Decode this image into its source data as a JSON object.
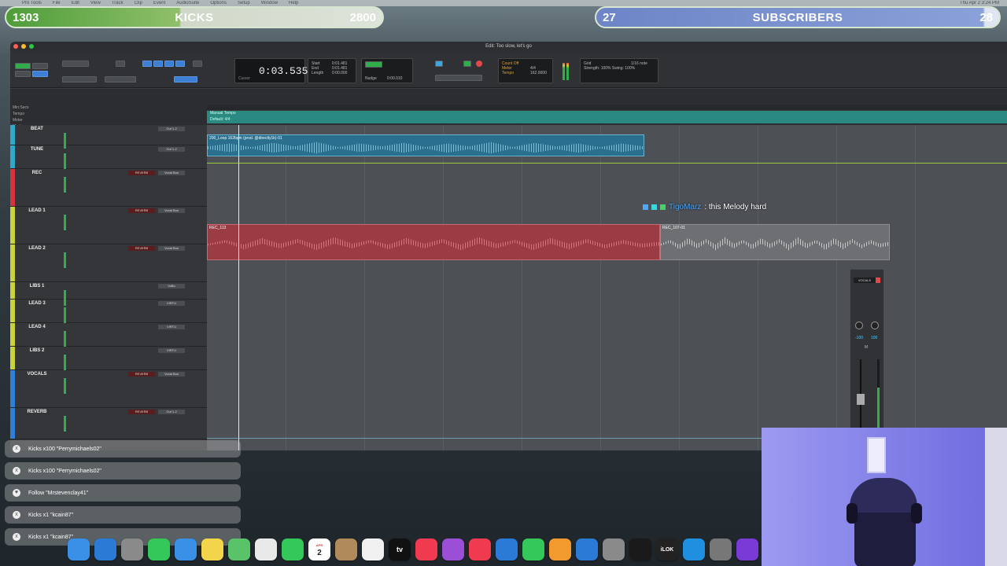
{
  "menubar": {
    "items": [
      "Pro Tools",
      "File",
      "Edit",
      "View",
      "Track",
      "Clip",
      "Event",
      "AudioSuite",
      "Options",
      "Setup",
      "Window",
      "Help"
    ],
    "clock": "Thu Apr 2  3:24 PM"
  },
  "goals": {
    "kicks": {
      "current": "1303",
      "label": "KICKS",
      "target": "2800",
      "progress": 0.465
    },
    "subs": {
      "current": "27",
      "label": "SUBSCRIBERS",
      "target": "28",
      "progress": 0.964
    }
  },
  "window": {
    "title": "Edit: Too slow, let's go"
  },
  "toolbar": {
    "counter": "0:03.535",
    "counter_caption": "Cursor",
    "start": "0:01.481",
    "end": "0:01.481",
    "length": "0:00.000",
    "nudge": "0:00.010",
    "grid": "1/16 note",
    "meter": "4/4",
    "tempo": "162.0000",
    "strength": "100%",
    "swing": "100%"
  },
  "rulers": {
    "labels": [
      "Min:Secs",
      "Tempo",
      "Meter",
      "Markers"
    ],
    "tempo_label": "Manual Tempo",
    "meter_label": "Default: 4/4"
  },
  "tracks": [
    {
      "name": "BEAT",
      "color": "#2fa8c9",
      "fx": "",
      "io": "Out 1-2"
    },
    {
      "name": "TUNE",
      "color": "#2fa8c9",
      "fx": "",
      "io": "Out 1-2"
    },
    {
      "name": "REC",
      "color": "#d6343c",
      "fx": "REVERB",
      "io": "Vocal Bus"
    },
    {
      "name": "LEAD 1",
      "color": "#c8d23a",
      "fx": "REVERB",
      "io": "Vocal Bus"
    },
    {
      "name": "LEAD 2",
      "color": "#c8d23a",
      "fx": "REVERB",
      "io": "Vocal Bus"
    },
    {
      "name": "LIBS 1",
      "color": "#c8d23a",
      "fx": "",
      "io": "VoBu"
    },
    {
      "name": "LEAD 3",
      "color": "#c8d23a",
      "fx": "",
      "io": "VIRTU"
    },
    {
      "name": "LEAD 4",
      "color": "#c8d23a",
      "fx": "",
      "io": "VIRTU"
    },
    {
      "name": "LIBS 2",
      "color": "#c8d23a",
      "fx": "",
      "io": "VIRTU"
    },
    {
      "name": "VOCALS",
      "color": "#2f7fd6",
      "fx": "REVERB",
      "io": "Vocal Bus"
    },
    {
      "name": "REVERB",
      "color": "#2f7fd6",
      "fx": "REVERB",
      "io": "Out 1-2"
    }
  ],
  "clips": {
    "beat": "200_Loop 162bpm (prod. @directly1k)-01",
    "rec_red": "REC_113",
    "rec_gray": "REC_107-01"
  },
  "chat": {
    "user": "TigoMarz",
    "message": ": this Melody hard"
  },
  "fader": {
    "name": "VOCALS",
    "vol": "-100",
    "pan": "100",
    "mute": "M"
  },
  "alerts": [
    {
      "icon": "x",
      "text": "Kicks x100 \"Perrymichaels02\""
    },
    {
      "icon": "x",
      "text": "Kicks x100 \"Perrymichaels02\""
    },
    {
      "icon": "♥",
      "text": "Follow \"Mrstevenclay41\""
    },
    {
      "icon": "x",
      "text": "Kicks x1 \"kcain87\""
    },
    {
      "icon": "x",
      "text": "Kicks x1 \"kcain87\""
    }
  ],
  "dock": {
    "apps": [
      {
        "name": "finder",
        "color": "#3a8fe6",
        "glyph": ""
      },
      {
        "name": "safari",
        "color": "#2a7ad6",
        "glyph": ""
      },
      {
        "name": "launchpad",
        "color": "#8a8a8a",
        "glyph": ""
      },
      {
        "name": "messages",
        "color": "#34c759",
        "glyph": ""
      },
      {
        "name": "mail",
        "color": "#3a8fe6",
        "glyph": ""
      },
      {
        "name": "notes",
        "color": "#f2d54a",
        "glyph": ""
      },
      {
        "name": "maps",
        "color": "#5ac36a",
        "glyph": ""
      },
      {
        "name": "photos",
        "color": "#e9e9e9",
        "glyph": ""
      },
      {
        "name": "facetime",
        "color": "#34c759",
        "glyph": ""
      },
      {
        "name": "calendar",
        "color": "#ffffff",
        "glyph": "2",
        "month": "APR"
      },
      {
        "name": "contacts",
        "color": "#b08a5a",
        "glyph": ""
      },
      {
        "name": "reminders",
        "color": "#f0f0f0",
        "glyph": ""
      },
      {
        "name": "tv",
        "color": "#111111",
        "glyph": "tv"
      },
      {
        "name": "music",
        "color": "#f03a50",
        "glyph": ""
      },
      {
        "name": "podcasts",
        "color": "#9b4fd6",
        "glyph": ""
      },
      {
        "name": "news",
        "color": "#f03a50",
        "glyph": ""
      },
      {
        "name": "keynote",
        "color": "#2a7ad6",
        "glyph": ""
      },
      {
        "name": "numbers",
        "color": "#34c759",
        "glyph": ""
      },
      {
        "name": "pages",
        "color": "#f29a2e",
        "glyph": ""
      },
      {
        "name": "app-store",
        "color": "#2a7ad6",
        "glyph": ""
      },
      {
        "name": "system-settings",
        "color": "#8a8a8a",
        "glyph": ""
      },
      {
        "name": "guitar-pro",
        "color": "#1a1a1a",
        "glyph": ""
      },
      {
        "name": "ilok",
        "color": "#222222",
        "glyph": "iLOK"
      },
      {
        "name": "circle-app",
        "color": "#1f8fe0",
        "glyph": ""
      },
      {
        "name": "settings-gear-app",
        "color": "#777777",
        "glyph": ""
      },
      {
        "name": "pro-tools",
        "color": "#7a3ad6",
        "glyph": ""
      }
    ]
  }
}
